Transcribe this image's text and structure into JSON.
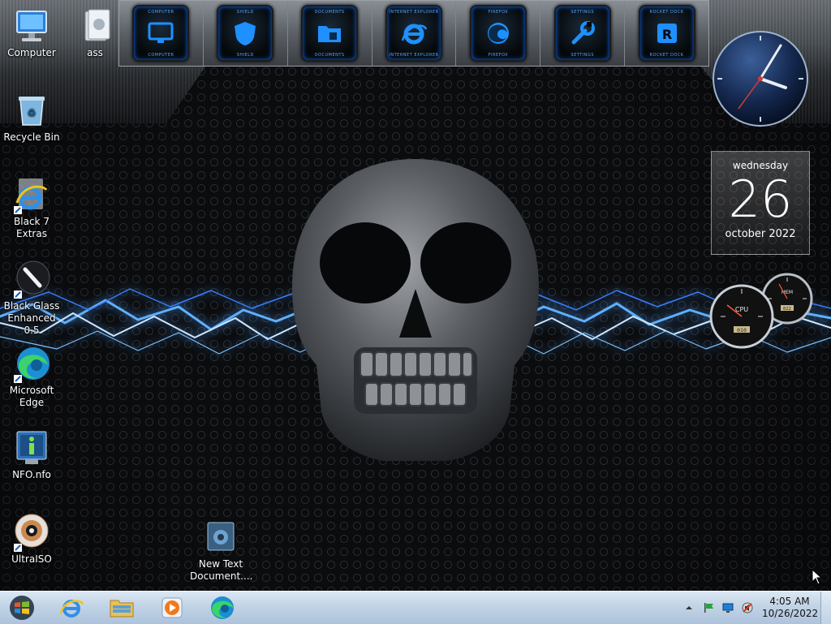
{
  "desktop_icons": [
    {
      "label": "Computer",
      "icon": "computer-icon"
    },
    {
      "label": "ass",
      "icon": "folder-icon"
    },
    {
      "label": "Recycle Bin",
      "icon": "recycle-bin-icon"
    },
    {
      "label": "Black 7 Extras",
      "icon": "internet-explorer-shortcut-icon"
    },
    {
      "label": "Black Glass Enhanced 0.5",
      "icon": "brush-shortcut-icon"
    },
    {
      "label": "Microsoft Edge",
      "icon": "edge-icon"
    },
    {
      "label": "NFO.nfo",
      "icon": "info-file-icon"
    },
    {
      "label": "UltraISO",
      "icon": "disc-icon"
    },
    {
      "label": "New Text Document....",
      "icon": "text-document-icon"
    }
  ],
  "dock": {
    "items": [
      {
        "caption": "COMPUTER",
        "icon": "monitor-icon"
      },
      {
        "caption": "SHIELD",
        "icon": "shield-icon"
      },
      {
        "caption": "DOCUMENTS",
        "icon": "documents-folder-icon"
      },
      {
        "caption": "INTERNET EXPLORER",
        "icon": "internet-explorer-icon"
      },
      {
        "caption": "FIREFOX",
        "icon": "firefox-icon"
      },
      {
        "caption": "SETTINGS",
        "icon": "wrench-icon"
      },
      {
        "caption": "ROCKET DOCK",
        "icon": "rocketdock-icon"
      }
    ]
  },
  "calendar": {
    "day": "wednesday",
    "date": "26",
    "month_year": "october 2022"
  },
  "gauges": {
    "cpu_label": "CPU",
    "mem_label": "MEM",
    "cpu_value": "010",
    "mem_value": "022"
  },
  "taskbar": {
    "pinned": [
      "internet-explorer-icon",
      "file-explorer-icon",
      "media-player-icon",
      "edge-icon"
    ],
    "time": "4:05 AM",
    "date": "10/26/2022"
  },
  "colors": {
    "accent_blue": "#1e90ff",
    "taskbar": "#c2d3e6"
  }
}
